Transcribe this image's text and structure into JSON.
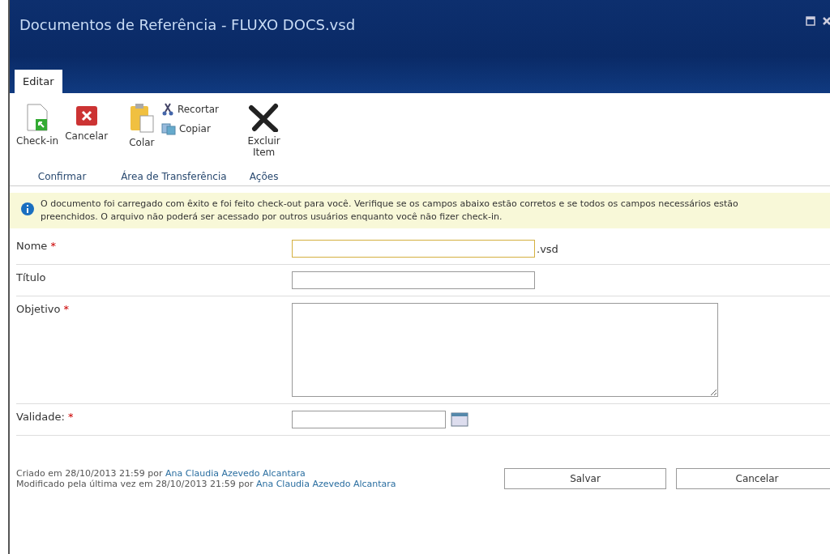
{
  "window": {
    "title": "Documentos de Referência - FLUXO DOCS.vsd"
  },
  "tabs": [
    {
      "label": "Editar",
      "selected": true
    }
  ],
  "ribbon": {
    "groups": [
      {
        "label": "Confirmar",
        "buttons": [
          {
            "label": "Check-in",
            "kind": "checkin"
          },
          {
            "label": "Cancelar",
            "kind": "cancel"
          }
        ]
      },
      {
        "label": "Área de Transferência",
        "buttons": [
          {
            "label": "Colar",
            "kind": "paste"
          }
        ],
        "small_buttons": [
          {
            "label": "Recortar",
            "kind": "cut"
          },
          {
            "label": "Copiar",
            "kind": "copy"
          }
        ]
      },
      {
        "label": "Ações",
        "buttons": [
          {
            "label": "Excluir Item",
            "kind": "delete"
          }
        ]
      }
    ]
  },
  "message": "O documento foi carregado com êxito e foi feito check-out para você. Verifique se os campos abaixo estão corretos e se todos os campos necessários estão preenchidos. O arquivo não poderá ser acessado por outros usuários enquanto você não fizer check-in.",
  "fields": [
    {
      "label": "Nome",
      "required_mark": "*",
      "kind": "text",
      "suffix": ".vsd"
    },
    {
      "label": "Título",
      "kind": "text"
    },
    {
      "label": "Objetivo",
      "required_mark": "*",
      "kind": "textarea"
    },
    {
      "label": "Validade:",
      "required_mark": "*",
      "kind": "date"
    }
  ],
  "footer": {
    "created": {
      "text": "Criado em 28/10/2013 21:59 por",
      "author": "Ana Claudia Azevedo Alcantara"
    },
    "modified": {
      "text": "Modificado pela última vez em 28/10/2013 21:59 por",
      "author": "Ana Claudia Azevedo Alcantara"
    }
  },
  "buttons": [
    "Salvar",
    "Cancelar"
  ]
}
